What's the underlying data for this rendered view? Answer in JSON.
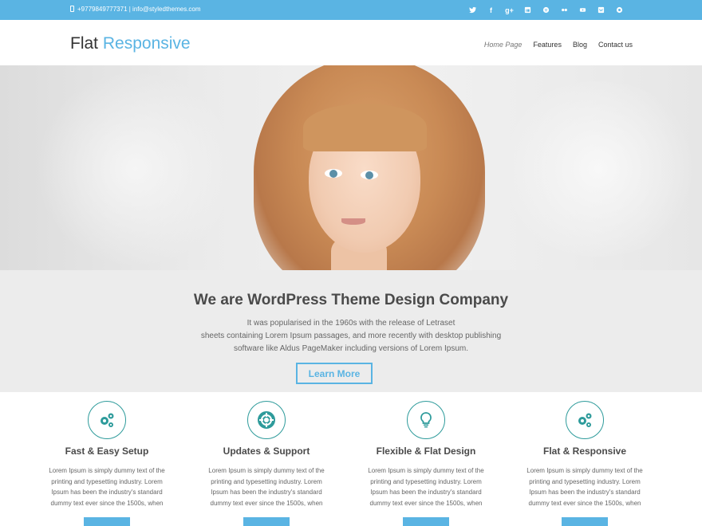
{
  "colors": {
    "accent": "#5ab4e3",
    "icon": "#2e9b9b",
    "intro_bg": "#ececec"
  },
  "topbar": {
    "contact": "+9779849777371 | info@styledthemes.com",
    "social": [
      "twitter-icon",
      "facebook-icon",
      "google-plus-icon",
      "linkedin-icon",
      "spotify-icon",
      "flickr-icon",
      "youtube-icon",
      "vk-icon",
      "dribbble-icon"
    ]
  },
  "header": {
    "logo_part1": "Flat",
    "logo_part2": "Responsive",
    "nav": [
      "Home Page",
      "Features",
      "Blog",
      "Contact us"
    ]
  },
  "intro": {
    "heading": "We are WordPress Theme Design Company",
    "lines": [
      "It was popularised in the 1960s with the release of Letraset",
      "sheets containing Lorem Ipsum passages, and more recently with desktop publishing",
      "software like Aldus PageMaker including versions of Lorem Ipsum."
    ],
    "button": "Learn More"
  },
  "features": [
    {
      "title": "Fast & Easy Setup",
      "icon": "cogs-icon",
      "lines": [
        "Lorem Ipsum is simply dummy text of the",
        "printing and typesetting industry. Lorem",
        "Ipsum has been the industry's standard",
        "dummy text ever since the 1500s, when"
      ]
    },
    {
      "title": "Updates & Support",
      "icon": "life-ring-icon",
      "lines": [
        "Lorem Ipsum is simply dummy text of the",
        "printing and typesetting industry. Lorem",
        "Ipsum has been the industry's standard",
        "dummy text ever since the 1500s, when"
      ]
    },
    {
      "title": "Flexible & Flat Design",
      "icon": "lightbulb-icon",
      "lines": [
        "Lorem Ipsum is simply dummy text of the",
        "printing and typesetting industry. Lorem",
        "Ipsum has been the industry's standard",
        "dummy text ever since the 1500s, when"
      ]
    },
    {
      "title": "Flat & Responsive",
      "icon": "cogs-icon",
      "lines": [
        "Lorem Ipsum is simply dummy text of the",
        "printing and typesetting industry. Lorem",
        "Ipsum has been the industry's standard",
        "dummy text ever since the 1500s, when"
      ]
    }
  ]
}
